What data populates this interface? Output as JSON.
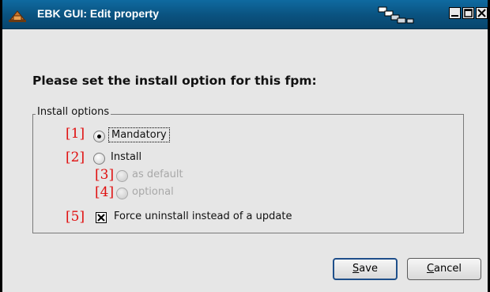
{
  "window": {
    "title": "EBK GUI: Edit property",
    "app_icon": "ebk-app-icon",
    "pager_icon": "workspace-pager-icon",
    "controls": [
      "minimize-icon",
      "maximize-icon",
      "close-icon"
    ]
  },
  "prompt": "Please set the install option for this fpm:",
  "group": {
    "legend": "Install options",
    "options": [
      {
        "tag": "[1]",
        "label": "Mandatory",
        "selected": true,
        "enabled": true
      },
      {
        "tag": "[2]",
        "label": "Install",
        "selected": false,
        "enabled": true
      },
      {
        "tag": "[3]",
        "label": "as default",
        "selected": false,
        "enabled": false
      },
      {
        "tag": "[4]",
        "label": "optional",
        "selected": false,
        "enabled": false
      }
    ],
    "checkbox": {
      "tag": "[5]",
      "label": "Force uninstall instead of a update",
      "checked": true
    }
  },
  "buttons": {
    "save": {
      "mnemonic": "S",
      "rest": "ave"
    },
    "cancel": {
      "mnemonic": "C",
      "rest": "ancel"
    }
  },
  "colors": {
    "titlebar": "#0a527f",
    "tag": "#e01010",
    "dialog_bg": "#e6e6e6",
    "default_button_border": "#1f4f8a"
  }
}
